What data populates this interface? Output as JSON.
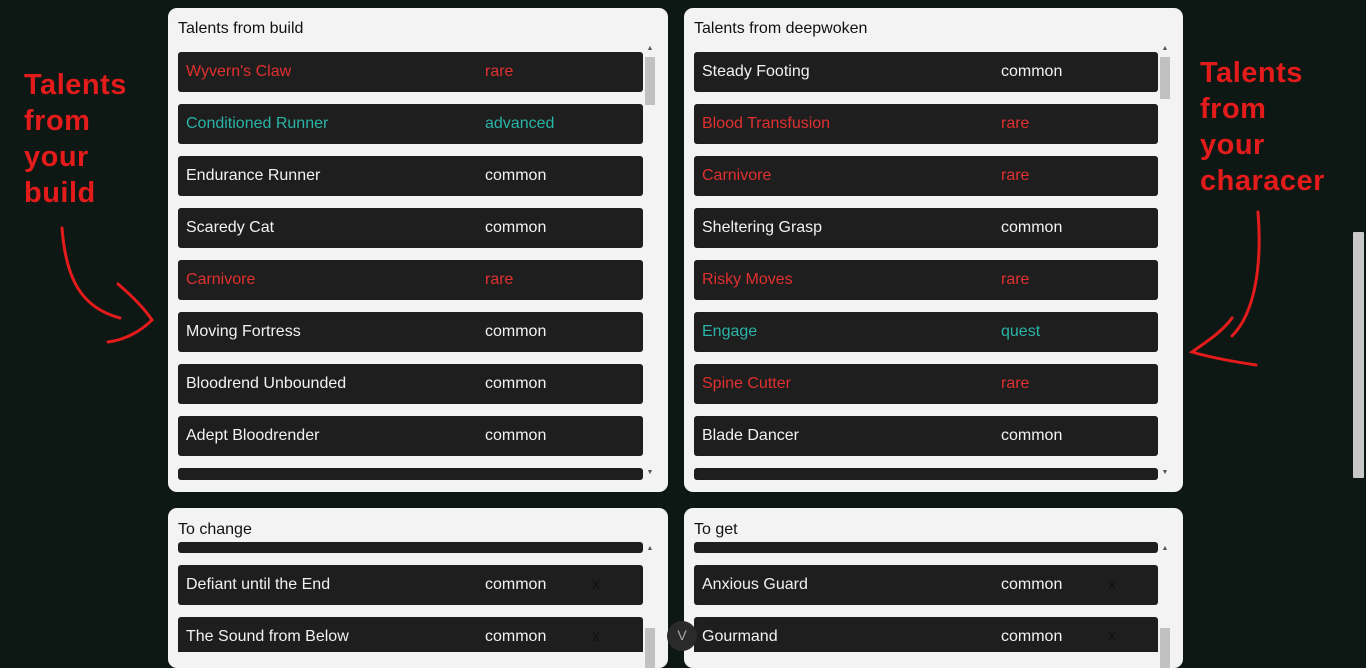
{
  "annotations": {
    "left": [
      "Talents",
      "from",
      "your",
      "build"
    ],
    "right": [
      "Talents",
      "from",
      "your",
      "characer"
    ]
  },
  "panels": {
    "build": {
      "title": "Talents from build",
      "items": [
        {
          "name": "Wyvern's Claw",
          "rarity": "rare"
        },
        {
          "name": "Conditioned Runner",
          "rarity": "advanced"
        },
        {
          "name": "Endurance Runner",
          "rarity": "common"
        },
        {
          "name": "Scaredy Cat",
          "rarity": "common"
        },
        {
          "name": "Carnivore",
          "rarity": "rare"
        },
        {
          "name": "Moving Fortress",
          "rarity": "common"
        },
        {
          "name": "Bloodrend Unbounded",
          "rarity": "common"
        },
        {
          "name": "Adept Bloodrender",
          "rarity": "common"
        }
      ]
    },
    "deepwoken": {
      "title": "Talents from deepwoken",
      "items": [
        {
          "name": "Steady Footing",
          "rarity": "common"
        },
        {
          "name": "Blood Transfusion",
          "rarity": "rare"
        },
        {
          "name": "Carnivore",
          "rarity": "rare"
        },
        {
          "name": "Sheltering Grasp",
          "rarity": "common"
        },
        {
          "name": "Risky Moves",
          "rarity": "rare"
        },
        {
          "name": "Engage",
          "rarity": "quest"
        },
        {
          "name": "Spine Cutter",
          "rarity": "rare"
        },
        {
          "name": "Blade Dancer",
          "rarity": "common"
        }
      ]
    },
    "to_change": {
      "title": "To change",
      "remove_label": "x",
      "items": [
        {
          "name": "Defiant until the End",
          "rarity": "common"
        },
        {
          "name": "The Sound from Below",
          "rarity": "common"
        }
      ]
    },
    "to_get": {
      "title": "To get",
      "remove_label": "x",
      "items": [
        {
          "name": "Anxious Guard",
          "rarity": "common"
        },
        {
          "name": "Gourmand",
          "rarity": "common"
        }
      ]
    }
  },
  "floating_button": {
    "label": "V"
  },
  "colors": {
    "background": "#0d1814",
    "panel": "#f3f3f3",
    "row": "#1e1e1e",
    "common": "#f2f2f2",
    "rare": "#e03030",
    "advanced": "#2ab3a6",
    "quest": "#2ab3a6",
    "annotation": "#e31b1b"
  }
}
